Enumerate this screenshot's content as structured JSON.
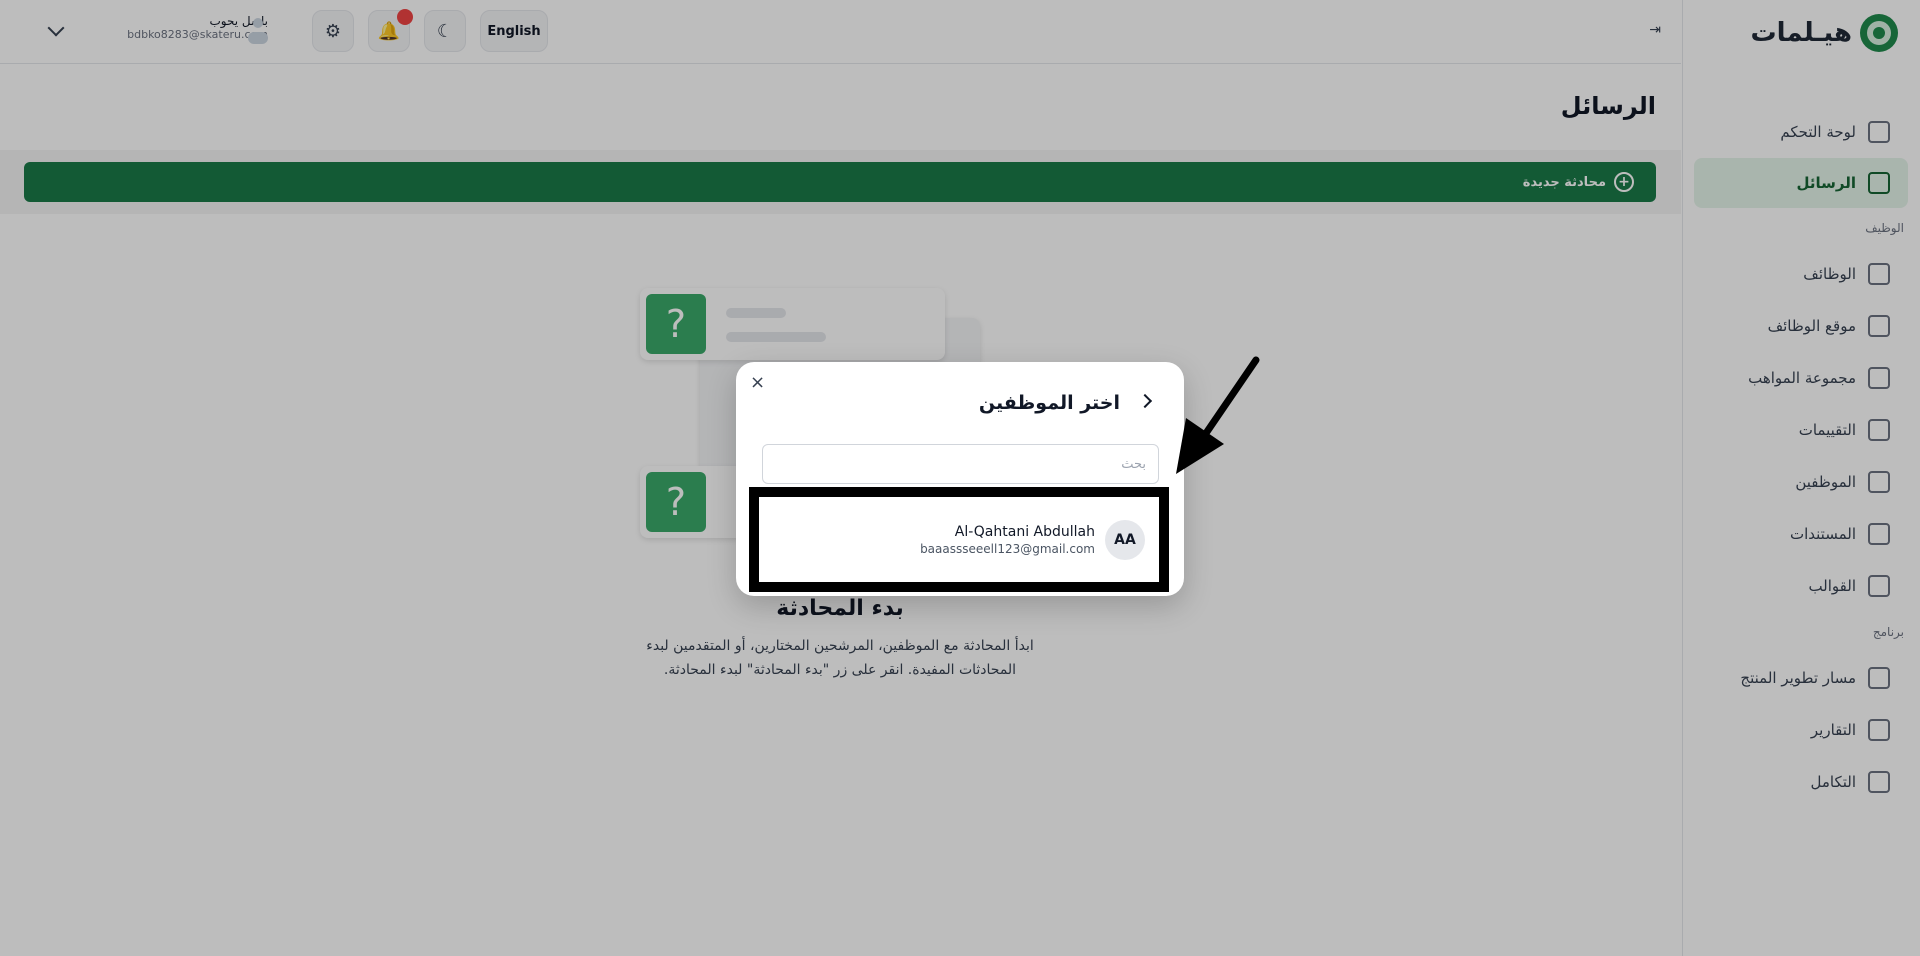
{
  "brand": {
    "name": "هيـلمات"
  },
  "sidebar": {
    "items": [
      {
        "label": "لوحة التحكم",
        "icon": "dashboard-icon"
      },
      {
        "label": "الرسائل",
        "icon": "mail-icon",
        "active": true
      }
    ],
    "section_jobs": "الوظيف",
    "job_items": [
      {
        "label": "الوظائف",
        "icon": "briefcase-icon"
      },
      {
        "label": "موقع الوظائف",
        "icon": "laptop-icon"
      },
      {
        "label": "مجموعة المواهب",
        "icon": "talent-icon"
      },
      {
        "label": "التقييمات",
        "icon": "store-icon"
      },
      {
        "label": "الموظفين",
        "icon": "user-icon"
      },
      {
        "label": "المستندات",
        "icon": "document-icon"
      },
      {
        "label": "القوالب",
        "icon": "template-icon"
      }
    ],
    "section_product": "برنامج",
    "product_items": [
      {
        "label": "مسار تطوير المنتج",
        "icon": "fire-icon"
      },
      {
        "label": "التقارير",
        "icon": "filter-icon"
      },
      {
        "label": "التكامل",
        "icon": "link-icon"
      }
    ]
  },
  "topbar": {
    "collapse_glyph": "⇥",
    "user_name": "باسل يحوب",
    "user_email": "bdbko8283@skateru.com",
    "language": "English",
    "notification_count_visible": true
  },
  "page": {
    "title": "الرسائل",
    "new_chat_label": "محادثة جديدة",
    "new_chat_plus": "+",
    "empty_title": "بدء المحادثة",
    "empty_desc": "ابدأ المحادثة مع الموظفين، المرشحين المختارين، أو المتقدمين لبدء المحادثات المفيدة. انقر على زر \"بدء المحادثة\" لبدء المحادثة.",
    "placeholder_q": "?"
  },
  "modal": {
    "title": "اختر الموظفين",
    "close_glyph": "×",
    "search_placeholder": "بحث",
    "search_value": "",
    "employees": [
      {
        "initials": "AA",
        "name": "Al-Qahtani Abdullah",
        "email": "baaassseeell123@gmail.com"
      }
    ]
  }
}
